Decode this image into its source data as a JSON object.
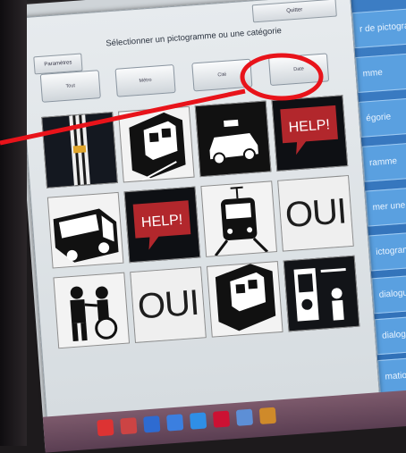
{
  "dialog": {
    "top_left_button": "Paramètres",
    "top_right_button": "Quitter",
    "title": "Sélectionner un pictogramme ou une catégorie",
    "category_buttons": [
      "Tout",
      "Métro",
      "Cité",
      "Date"
    ]
  },
  "tiles": [
    {
      "kind": "platform-tracks-icon"
    },
    {
      "kind": "metro-station-icon"
    },
    {
      "kind": "taxi-icon"
    },
    {
      "kind": "help-bubble-icon",
      "text": "HELP!"
    },
    {
      "kind": "bus-icon"
    },
    {
      "kind": "help-bubble-icon",
      "text": "HELP!"
    },
    {
      "kind": "tram-icon"
    },
    {
      "kind": "oui-word",
      "text": "OUI"
    },
    {
      "kind": "assistance-staff-icon"
    },
    {
      "kind": "oui-word",
      "text": "OUI"
    },
    {
      "kind": "metro-station-icon"
    },
    {
      "kind": "ticket-gate-icon"
    }
  ],
  "side_panel": {
    "items": [
      "r de pictogram",
      "mme",
      "égorie",
      "ramme",
      "mer une ou",
      "ictogramme(",
      "dialogue",
      "dialogue p",
      "mation"
    ]
  },
  "colors": {
    "side_panel": "#3d7ec5",
    "side_item": "#5aa0e0",
    "annotation": "#e8131a",
    "help_bubble": "#b2272c"
  }
}
